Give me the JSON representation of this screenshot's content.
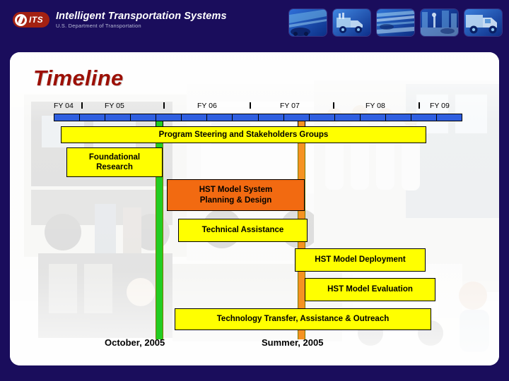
{
  "header": {
    "logo_badge_text": "ITS",
    "logo_seal_icon": "dot-triskelion-seal-icon",
    "title": "Intelligent Transportation Systems",
    "subtitle": "U.S. Department of Transportation",
    "thumbnails": [
      {
        "name": "thumbnail-highway-car",
        "alt": "highway with car at night"
      },
      {
        "name": "thumbnail-tow-truck",
        "alt": "commercial tow truck"
      },
      {
        "name": "thumbnail-motion-blur-traffic",
        "alt": "blurred moving traffic"
      },
      {
        "name": "thumbnail-street-intersection",
        "alt": "urban street intersection"
      },
      {
        "name": "thumbnail-freight-truck",
        "alt": "freight semi truck"
      }
    ]
  },
  "slide": {
    "title": "Timeline"
  },
  "chart_data": {
    "type": "bar",
    "title": "Timeline",
    "orientation": "horizontal-gantt",
    "xlabel": "",
    "ylabel": "",
    "axis": {
      "fiscal_year_labels": [
        "FY 04",
        "FY 05",
        "FY 06",
        "FY 07",
        "FY 08",
        "FY 09"
      ],
      "quarter_segments": 16,
      "bar_color": "#2f5fe0",
      "grid": false
    },
    "milestones": [
      {
        "label": "October, 2005",
        "color": "#22cc22",
        "x_fraction": 0.277
      },
      {
        "label": "Summer, 2005",
        "color": "#f59222",
        "x_fraction": 0.625
      }
    ],
    "tasks": [
      {
        "label": "Program Steering and Stakeholders Groups",
        "color": "#ffff00",
        "start_fraction": 0.035,
        "end_fraction": 0.93
      },
      {
        "label": "Foundational\nResearch",
        "line1": "Foundational",
        "line2": "Research",
        "color": "#ffff00",
        "start_fraction": 0.055,
        "end_fraction": 0.272
      },
      {
        "label": "HST Model System Planning & Design",
        "line1": "HST Model System",
        "line2": "Planning & Design",
        "color": "#f26a11",
        "start_fraction": 0.286,
        "end_fraction": 0.626
      },
      {
        "label": "Technical Assistance",
        "line1": "Technical Assistance",
        "color": "#ffff00",
        "start_fraction": 0.348,
        "end_fraction": 0.632
      },
      {
        "label": "HST Model Deployment",
        "line1": "HST Model Deployment",
        "color": "#ffff00",
        "start_fraction": 0.602,
        "end_fraction": 0.873
      },
      {
        "label": "HST Model Evaluation",
        "line1": "HST Model Evaluation",
        "color": "#ffff00",
        "start_fraction": 0.624,
        "end_fraction": 0.883
      },
      {
        "label": "Technology Transfer, Assistance & Outreach",
        "line1": "Technology Transfer, Assistance & Outreach",
        "color": "#ffff00",
        "start_fraction": 0.338,
        "end_fraction": 0.895
      }
    ],
    "captions": [
      {
        "text": "October, 2005",
        "x_fraction": 0.215
      },
      {
        "text": "Summer, 2005",
        "x_fraction": 0.535
      }
    ]
  },
  "colors": {
    "background_navy": "#1a0d5c",
    "panel_white": "#ffffff",
    "title_red": "#9c1006",
    "bar_yellow": "#ffff00",
    "bar_orange": "#f26a11",
    "axis_blue": "#2f5fe0",
    "milestone_green": "#22cc22",
    "milestone_orange": "#f59222",
    "logo_red": "#a32112"
  }
}
